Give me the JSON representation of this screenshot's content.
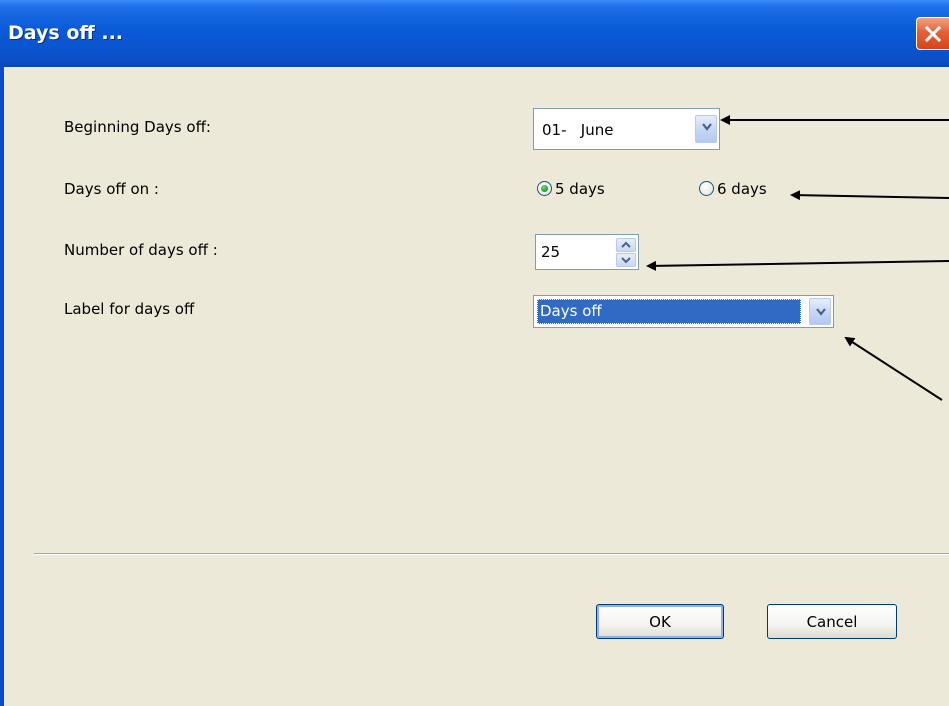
{
  "window": {
    "title": "Days off ...",
    "close_label": "×"
  },
  "form": {
    "beginning_label": "Beginning Days off:",
    "beginning_value": "01-   June",
    "days_on_label": "Days off on :",
    "radio_5_label": "5 days",
    "radio_6_label": "6 days",
    "radio_selected": "5 days",
    "number_label": "Number of days off :",
    "number_value": "25",
    "label_label": "Label for days off",
    "label_value": "Days off"
  },
  "buttons": {
    "ok": "OK",
    "cancel": "Cancel"
  },
  "colors": {
    "dialog_bg": "#ece9d8",
    "titlebar": "#0a55d0",
    "selection": "#316ac5",
    "close_button": "#e5603a"
  },
  "icons": [
    "close-icon",
    "chevron-down-icon",
    "spin-up-icon",
    "spin-down-icon",
    "radio-selected-icon",
    "radio-empty-icon",
    "annotation-arrow"
  ]
}
